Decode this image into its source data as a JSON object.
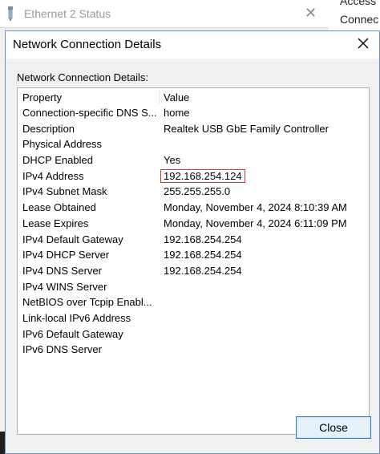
{
  "background_window": {
    "title": "Ethernet 2 Status",
    "close_glyph": "✕"
  },
  "right_window": {
    "line1": "Access",
    "line2": "Connec"
  },
  "dialog": {
    "title": "Network Connection Details",
    "group_label": "Network Connection Details:",
    "columns": {
      "property": "Property",
      "value": "Value"
    },
    "rows": [
      {
        "property": "Connection-specific DNS S...",
        "value": "home"
      },
      {
        "property": "Description",
        "value": "Realtek USB GbE Family Controller"
      },
      {
        "property": "Physical Address",
        "value": ""
      },
      {
        "property": "DHCP Enabled",
        "value": "Yes"
      },
      {
        "property": "IPv4 Address",
        "value": "192.168.254.124"
      },
      {
        "property": "IPv4 Subnet Mask",
        "value": "255.255.255.0"
      },
      {
        "property": "Lease Obtained",
        "value": "Monday, November 4, 2024 8:10:39 AM"
      },
      {
        "property": "Lease Expires",
        "value": "Monday, November 4, 2024 6:11:09 PM"
      },
      {
        "property": "IPv4 Default Gateway",
        "value": "192.168.254.254"
      },
      {
        "property": "IPv4 DHCP Server",
        "value": "192.168.254.254"
      },
      {
        "property": "IPv4 DNS Server",
        "value": "192.168.254.254"
      },
      {
        "property": "IPv4 WINS Server",
        "value": ""
      },
      {
        "property": "NetBIOS over Tcpip Enabl...",
        "value": ""
      },
      {
        "property": "Link-local IPv6 Address",
        "value": ""
      },
      {
        "property": "IPv6 Default Gateway",
        "value": ""
      },
      {
        "property": "IPv6 DNS Server",
        "value": ""
      }
    ],
    "close_label": "Close"
  },
  "colors": {
    "highlight_box": "#d9372f",
    "dialog_border": "#6b8cc7",
    "button_border": "#2e7bd1"
  },
  "icons": {
    "title_bar": "network-adapter-icon",
    "close": "close-icon"
  }
}
